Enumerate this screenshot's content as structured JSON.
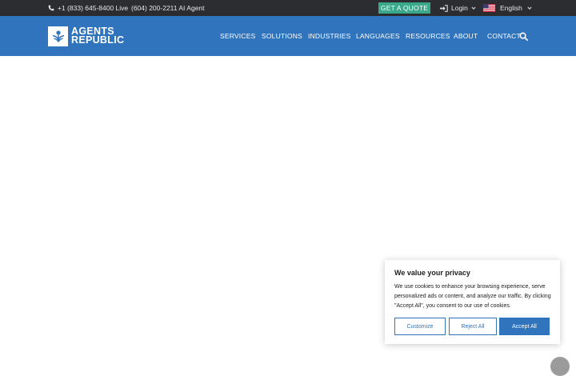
{
  "topbar": {
    "phone_live": "+1 (833) 645-8400 Live",
    "phone_ai": "(604) 200-2211 AI Agent",
    "quote_label": "GET A QUOTE",
    "login_label": "Login",
    "language_label": "English"
  },
  "brand": {
    "line1": "AGENTS",
    "line2": "REPUBLIC"
  },
  "nav": {
    "items": [
      "SERVICES",
      "SOLUTIONS",
      "INDUSTRIES",
      "LANGUAGES",
      "RESOURCES",
      "ABOUT",
      "CONTACT"
    ]
  },
  "cookie": {
    "title": "We value your privacy",
    "text": "We use cookies to enhance your browsing experience, serve personalized ads or content, and analyze our traffic. By clicking \"Accept All\", you consent to our use of cookies.",
    "customize_label": "Customize",
    "reject_label": "Reject All",
    "accept_label": "Accept All"
  },
  "colors": {
    "topbar_bg": "#2b2d31",
    "nav_bg": "#2f74bd",
    "quote_bg": "#3aa88a",
    "accent": "#2f74bd"
  },
  "icons": [
    "phone-icon",
    "sign-in-icon",
    "us-flag-icon",
    "chevron-down-icon",
    "search-icon",
    "brand-logo-icon"
  ]
}
